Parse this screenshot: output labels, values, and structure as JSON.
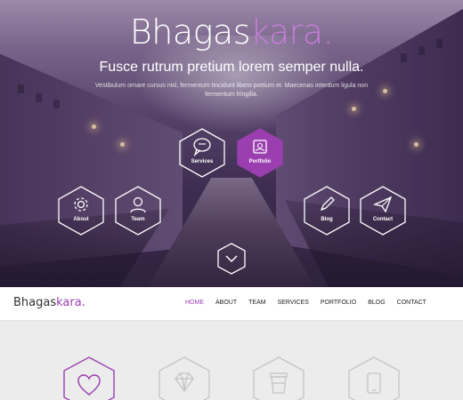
{
  "brand": {
    "part1": "Bhagas",
    "part2": "kara",
    "dot": "."
  },
  "hero": {
    "tagline": "Fusce rutrum pretium lorem semper nulla.",
    "subtext": "Vestibulum ornare cursus nisl, fermentum tincidunt libero pretium et. Maecenas interdum ligula non fermentum fringilla."
  },
  "hex_menu": [
    {
      "label": "Services",
      "icon": "chat-bubble-icon"
    },
    {
      "label": "Portfolio",
      "icon": "picture-icon",
      "active": true
    },
    {
      "label": "About",
      "icon": "gear-icon"
    },
    {
      "label": "Team",
      "icon": "user-icon"
    },
    {
      "label": "Blog",
      "icon": "pencil-icon"
    },
    {
      "label": "Contact",
      "icon": "paper-plane-icon"
    }
  ],
  "nav": {
    "links": [
      "HOME",
      "ABOUT",
      "TEAM",
      "SERVICES",
      "PORTFOLIO",
      "BLOG",
      "CONTACT"
    ],
    "active": "HOME"
  },
  "features": [
    {
      "icon": "heart-icon",
      "active": true
    },
    {
      "icon": "diamond-icon"
    },
    {
      "icon": "coffee-cup-icon"
    },
    {
      "icon": "tablet-icon"
    }
  ],
  "colors": {
    "accent": "#9b3fb0",
    "accent_light": "#c77dd8",
    "white": "#ffffff",
    "muted": "#bdbdbd"
  }
}
